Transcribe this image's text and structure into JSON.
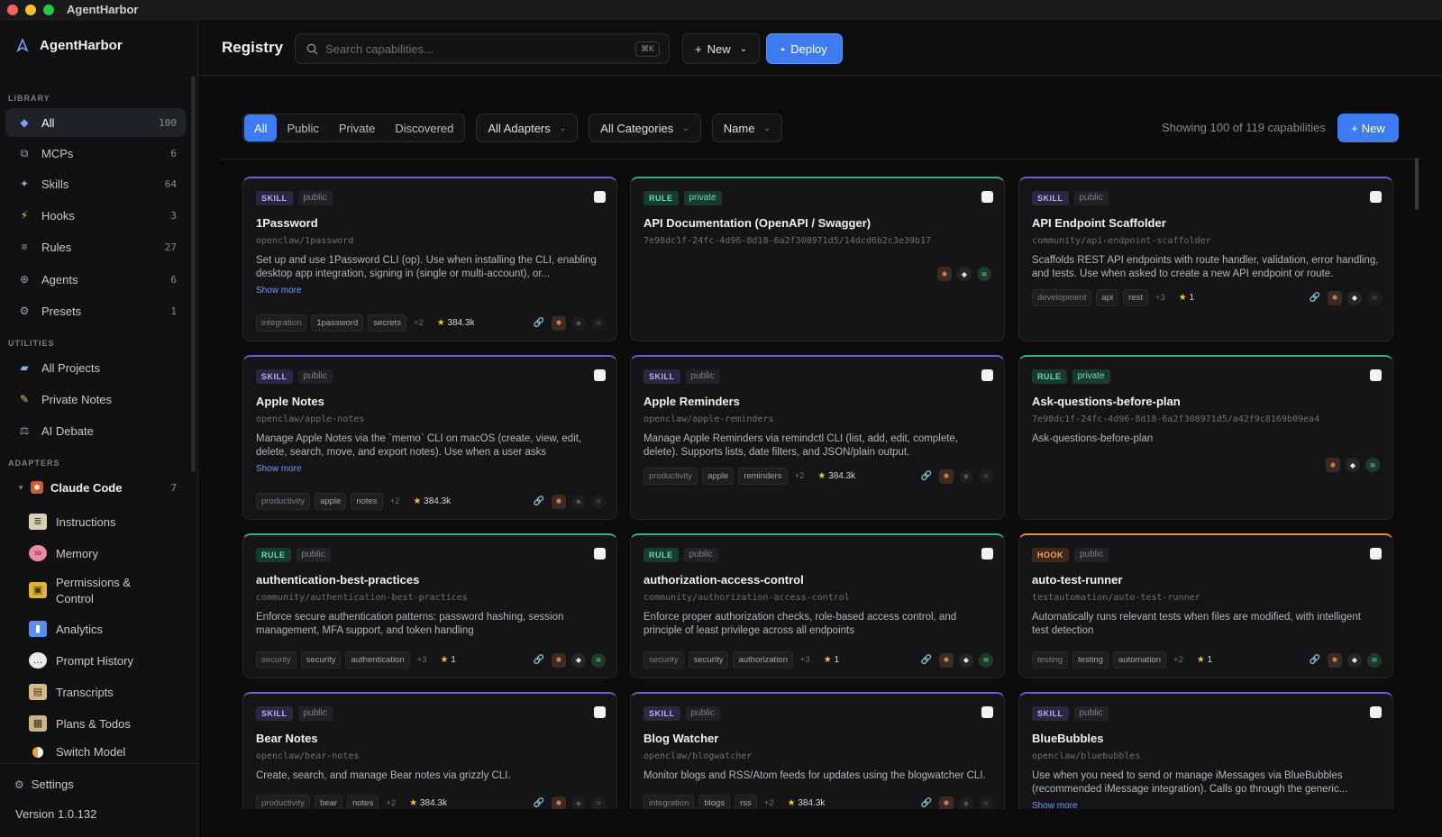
{
  "window": {
    "title": "AgentHarbor"
  },
  "sidebar": {
    "brand": "AgentHarbor",
    "library_label": "LIBRARY",
    "library": [
      {
        "label": "All",
        "count": "100",
        "icon": "diamond-icon"
      },
      {
        "label": "MCPs",
        "count": "6",
        "icon": "mcp-icon"
      },
      {
        "label": "Skills",
        "count": "64",
        "icon": "sparkle-icon"
      },
      {
        "label": "Hooks",
        "count": "3",
        "icon": "bolt-icon"
      },
      {
        "label": "Rules",
        "count": "27",
        "icon": "lines-icon"
      },
      {
        "label": "Agents",
        "count": "6",
        "icon": "agent-icon"
      },
      {
        "label": "Presets",
        "count": "1",
        "icon": "gear-icon"
      }
    ],
    "utilities_label": "UTILITIES",
    "utilities": [
      {
        "label": "All Projects",
        "icon": "folder-icon"
      },
      {
        "label": "Private Notes",
        "icon": "note-icon"
      },
      {
        "label": "AI Debate",
        "icon": "scale-icon"
      }
    ],
    "adapters_label": "ADAPTERS",
    "adapter": {
      "label": "Claude Code",
      "count": "7"
    },
    "adapter_items": [
      {
        "label": "Instructions",
        "icon": "doc-icon"
      },
      {
        "label": "Memory",
        "icon": "brain-icon"
      },
      {
        "label": "Permissions &",
        "label2": "Control",
        "icon": "lock-icon"
      },
      {
        "label": "Analytics",
        "icon": "chart-icon"
      },
      {
        "label": "Prompt History",
        "icon": "chat-icon"
      },
      {
        "label": "Transcripts",
        "icon": "scroll-icon"
      },
      {
        "label": "Plans & Todos",
        "icon": "clipboard-icon"
      },
      {
        "label": "Switch Model",
        "icon": "switch-icon"
      }
    ],
    "settings": "Settings",
    "version": "Version 1.0.132"
  },
  "header": {
    "title": "Registry",
    "search_placeholder": "Search capabilities...",
    "kbd": "⌘K",
    "new_label": "New",
    "deploy_label": "Deploy"
  },
  "filters": {
    "segments": [
      "All",
      "Public",
      "Private",
      "Discovered"
    ],
    "adapters": "All Adapters",
    "categories": "All Categories",
    "sort": "Name",
    "showing": "Showing 100 of 119 capabilities",
    "new_label": "New"
  },
  "cards": [
    {
      "type": "SKILL",
      "vis": "public",
      "title": "1Password",
      "path": "openclaw/1password",
      "desc": "Set up and use 1Password CLI (op). Use when installing the CLI, enabling desktop app integration, signing in (single or multi-account), or...",
      "more": "Show more",
      "tags": [
        "integration",
        "1password",
        "secrets"
      ],
      "plus": "+2",
      "stars": "384.3k"
    },
    {
      "type": "RULE",
      "vis": "private",
      "title": "API Documentation (OpenAPI / Swagger)",
      "path": "7e98dc1f-24fc-4d96-8d18-6a2f308971d5/14dcd6b2c3e39b17",
      "desc": "",
      "more": "",
      "tags": [],
      "plus": "",
      "stars": ""
    },
    {
      "type": "SKILL",
      "vis": "public",
      "title": "API Endpoint Scaffolder",
      "path": "community/api-endpoint-scaffolder",
      "desc": "Scaffolds REST API endpoints with route handler, validation, error handling, and tests. Use when asked to create a new API endpoint or route.",
      "more": "",
      "tags": [
        "development",
        "api",
        "rest"
      ],
      "plus": "+3",
      "stars": "1"
    },
    {
      "type": "SKILL",
      "vis": "public",
      "title": "Apple Notes",
      "path": "openclaw/apple-notes",
      "desc": "Manage Apple Notes via the `memo` CLI on macOS (create, view, edit, delete, search, move, and export notes). Use when a user asks OpenClaw...",
      "more": "Show more",
      "tags": [
        "productivity",
        "apple",
        "notes"
      ],
      "plus": "+2",
      "stars": "384.3k"
    },
    {
      "type": "SKILL",
      "vis": "public",
      "title": "Apple Reminders",
      "path": "openclaw/apple-reminders",
      "desc": "Manage Apple Reminders via remindctl CLI (list, add, edit, complete, delete). Supports lists, date filters, and JSON/plain output.",
      "more": "",
      "tags": [
        "productivity",
        "apple",
        "reminders"
      ],
      "plus": "+2",
      "stars": "384.3k"
    },
    {
      "type": "RULE",
      "vis": "private",
      "title": "Ask-questions-before-plan",
      "path": "7e98dc1f-24fc-4d96-8d18-6a2f308971d5/a42f9c8169b09ea4",
      "desc": "Ask-questions-before-plan",
      "more": "",
      "tags": [],
      "plus": "",
      "stars": ""
    },
    {
      "type": "RULE",
      "vis": "public",
      "title": "authentication-best-practices",
      "path": "community/authentication-best-practices",
      "desc": "Enforce secure authentication patterns: password hashing, session management, MFA support, and token handling",
      "more": "",
      "tags": [
        "security",
        "security",
        "authentication"
      ],
      "plus": "+3",
      "stars": "1"
    },
    {
      "type": "RULE",
      "vis": "public",
      "title": "authorization-access-control",
      "path": "community/authorization-access-control",
      "desc": "Enforce proper authorization checks, role-based access control, and principle of least privilege across all endpoints",
      "more": "",
      "tags": [
        "security",
        "security",
        "authorization"
      ],
      "plus": "+3",
      "stars": "1"
    },
    {
      "type": "HOOK",
      "vis": "public",
      "title": "auto-test-runner",
      "path": "testautomation/auto-test-runner",
      "desc": "Automatically runs relevant tests when files are modified, with intelligent test detection",
      "more": "",
      "tags": [
        "testing",
        "testing",
        "automation"
      ],
      "plus": "+2",
      "stars": "1"
    },
    {
      "type": "SKILL",
      "vis": "public",
      "title": "Bear Notes",
      "path": "openclaw/bear-notes",
      "desc": "Create, search, and manage Bear notes via grizzly CLI.",
      "more": "",
      "tags": [
        "productivity",
        "bear",
        "notes"
      ],
      "plus": "+2",
      "stars": "384.3k"
    },
    {
      "type": "SKILL",
      "vis": "public",
      "title": "Blog Watcher",
      "path": "openclaw/blogwatcher",
      "desc": "Monitor blogs and RSS/Atom feeds for updates using the blogwatcher CLI.",
      "more": "",
      "tags": [
        "integration",
        "blogs",
        "rss"
      ],
      "plus": "+2",
      "stars": "384.3k"
    },
    {
      "type": "SKILL",
      "vis": "public",
      "title": "BlueBubbles",
      "path": "openclaw/bluebubbles",
      "desc": "Use when you need to send or manage iMessages via BlueBubbles (recommended iMessage integration). Calls go through the generic...",
      "more": "Show more",
      "tags": [],
      "plus": "",
      "stars": ""
    }
  ]
}
